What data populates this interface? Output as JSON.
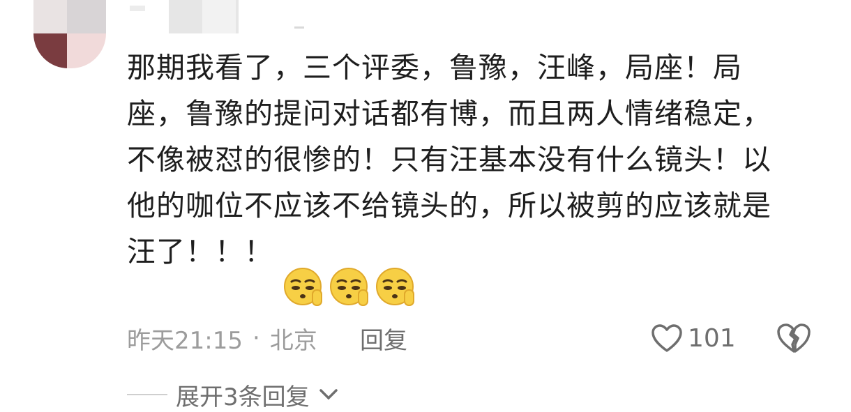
{
  "comment": {
    "lines": [
      "那期我看了，三个评委，鲁豫，汪峰，局座！局",
      "座，鲁豫的提问对话都有博，而且两人情绪稳定，",
      "不像被怼的很惨的！只有汪基本没有什么镜头！以",
      "他的咖位不应该不给镜头的，所以被剪的应该就是",
      "汪了！！！"
    ],
    "emojis": [
      "shush-emoji",
      "shush-emoji",
      "shush-emoji"
    ]
  },
  "meta": {
    "time": "昨天21:15",
    "separator": "·",
    "location": "北京",
    "reply_label": "回复"
  },
  "like": {
    "count": "101"
  },
  "expand": {
    "label": "展开3条回复"
  },
  "colors": {
    "text": "#1e1e1e",
    "meta": "#9c9c9c",
    "action": "#6e6e6e",
    "emoji_face": "#f7cf45"
  }
}
